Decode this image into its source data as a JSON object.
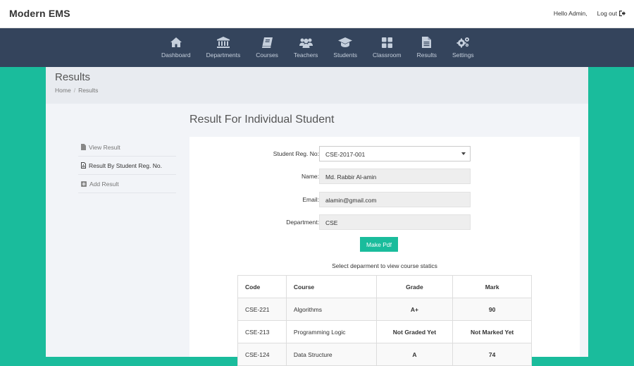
{
  "app": {
    "brand": "Modern EMS"
  },
  "topbar": {
    "greeting": "Hello Admin,",
    "logout": "Log out"
  },
  "nav": [
    {
      "label": "Dashboard",
      "icon": "home-icon"
    },
    {
      "label": "Departments",
      "icon": "bank-icon"
    },
    {
      "label": "Courses",
      "icon": "book-icon"
    },
    {
      "label": "Teachers",
      "icon": "users-icon"
    },
    {
      "label": "Students",
      "icon": "graduation-cap-icon"
    },
    {
      "label": "Classroom",
      "icon": "grid-icon"
    },
    {
      "label": "Results",
      "icon": "file-text-icon"
    },
    {
      "label": "Settings",
      "icon": "gears-icon"
    }
  ],
  "page": {
    "title": "Results",
    "breadcrumb": [
      "Home",
      "Results"
    ]
  },
  "sidebar": [
    {
      "label": "View Result",
      "icon": "file-icon"
    },
    {
      "label": "Result By Student Reg. No.",
      "icon": "file-pdf-icon"
    },
    {
      "label": "Add Result",
      "icon": "plus-square-icon"
    }
  ],
  "main": {
    "title": "Result For Individual Student",
    "form": {
      "reg_label": "Student Reg. No:",
      "reg_value": "CSE-2017-001",
      "name_label": "Name:",
      "name_value": "Md. Rabbir Al-amin",
      "email_label": "Email:",
      "email_value": "alamin@gmail.com",
      "dept_label": "Department:",
      "dept_value": "CSE"
    },
    "pdf_button": "Make Pdf",
    "hint": "Select deparment to view course statics"
  },
  "table": {
    "headers": [
      "Code",
      "Course",
      "Grade",
      "Mark"
    ],
    "rows": [
      [
        "CSE-221",
        "Algorithms",
        "A+",
        "90"
      ],
      [
        "CSE-213",
        "Programming Logic",
        "Not Graded Yet",
        "Not Marked Yet"
      ],
      [
        "CSE-124",
        "Data Structure",
        "A",
        "74"
      ]
    ]
  },
  "colors": {
    "accent": "#1abc9c",
    "navbar": "#34445c"
  }
}
